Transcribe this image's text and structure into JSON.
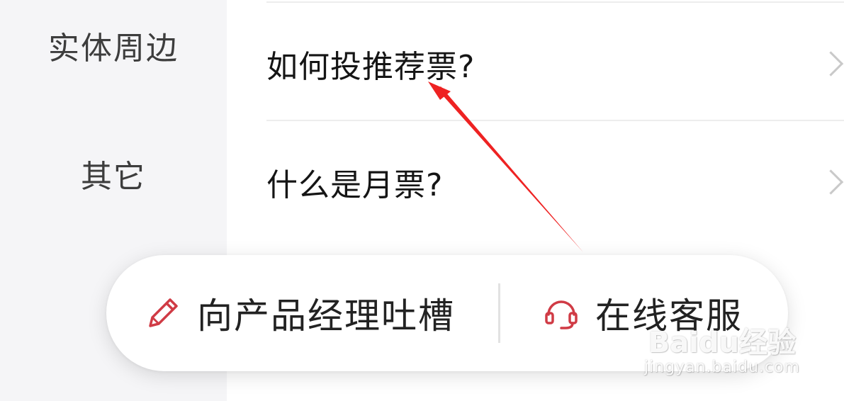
{
  "sidebar": {
    "items": [
      {
        "label": "实体周边"
      },
      {
        "label": "其它"
      }
    ]
  },
  "faq": {
    "items": [
      {
        "question": "如何投推荐票?"
      },
      {
        "question": "什么是月票?"
      }
    ]
  },
  "action_bar": {
    "feedback_label": "向产品经理吐槽",
    "service_label": "在线客服"
  },
  "watermark": {
    "brand": "Baidu经验",
    "url": "jingyan.baidu.com"
  },
  "colors": {
    "accent": "#d03b45",
    "annotation_arrow": "#ee2222",
    "sidebar_bg": "#f5f5f7"
  },
  "icons": {
    "feedback": "pencil-icon",
    "service": "headset-icon",
    "item_arrow": "chevron-right-icon"
  }
}
